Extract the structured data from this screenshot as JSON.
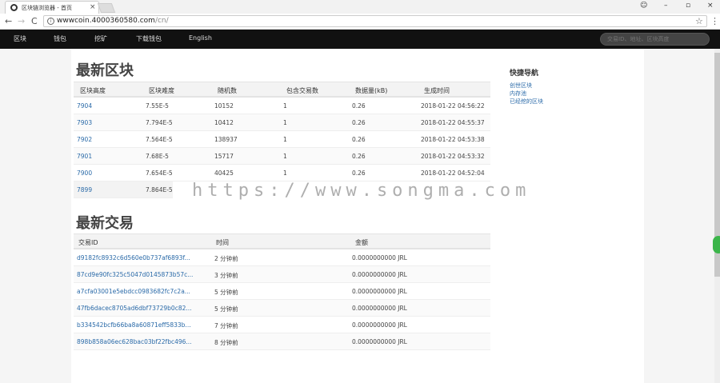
{
  "browser": {
    "tab_title": "区块链浏览器 - 首页",
    "tab_close": "×",
    "url_host": "wwwcoin.4000360580.com",
    "url_path": "/cn/",
    "star": "☆",
    "menu": "⋮",
    "win_user": "☺",
    "win_min": "–",
    "win_max": "▫",
    "win_close": "×",
    "back": "←",
    "forward": "→",
    "reload": "C",
    "info": "i"
  },
  "nav": {
    "items": [
      "区块",
      "钱包",
      "挖矿",
      "下载钱包",
      "English"
    ],
    "search_placeholder": "交易ID、地址、区块高度"
  },
  "blocks": {
    "title": "最新区块",
    "headers": [
      "区块高度",
      "区块难度",
      "随机数",
      "包含交易数",
      "数据量(kB)",
      "生成时间"
    ],
    "rows": [
      [
        "7904",
        "7.55E-5",
        "10152",
        "1",
        "0.26",
        "2018-01-22 04:56:22"
      ],
      [
        "7903",
        "7.794E-5",
        "10412",
        "1",
        "0.26",
        "2018-01-22 04:55:37"
      ],
      [
        "7902",
        "7.564E-5",
        "138937",
        "1",
        "0.26",
        "2018-01-22 04:53:38"
      ],
      [
        "7901",
        "7.68E-5",
        "15717",
        "1",
        "0.26",
        "2018-01-22 04:53:32"
      ],
      [
        "7900",
        "7.654E-5",
        "40425",
        "1",
        "0.26",
        "2018-01-22 04:52:04"
      ],
      [
        "7899",
        "7.864E-5",
        "",
        "",
        "",
        ""
      ]
    ]
  },
  "transactions": {
    "title": "最新交易",
    "headers": [
      "交易ID",
      "时间",
      "金额"
    ],
    "rows": [
      [
        "d9182fc8932c6d560e0b737af6893f...",
        "2 分钟前",
        "0.0000000000 JRL"
      ],
      [
        "87cd9e90fc325c5047d0145873b57c...",
        "3 分钟前",
        "0.0000000000 JRL"
      ],
      [
        "a7cfa03001e5ebdcc0983682fc7c2a...",
        "5 分钟前",
        "0.0000000000 JRL"
      ],
      [
        "47fb6dacec8705ad6dbf73729b0c82...",
        "5 分钟前",
        "0.0000000000 JRL"
      ],
      [
        "b334542bcfb66ba8a60871eff5833b...",
        "7 分钟前",
        "0.0000000000 JRL"
      ],
      [
        "898b858a06ec628bac03bf22fbc496...",
        "8 分钟前",
        "0.0000000000 JRL"
      ]
    ]
  },
  "quicknav": {
    "title": "快捷导航",
    "links": [
      "创世区块",
      "内存池",
      "已经挖的区块"
    ]
  },
  "watermark": "https://www.songma.com"
}
